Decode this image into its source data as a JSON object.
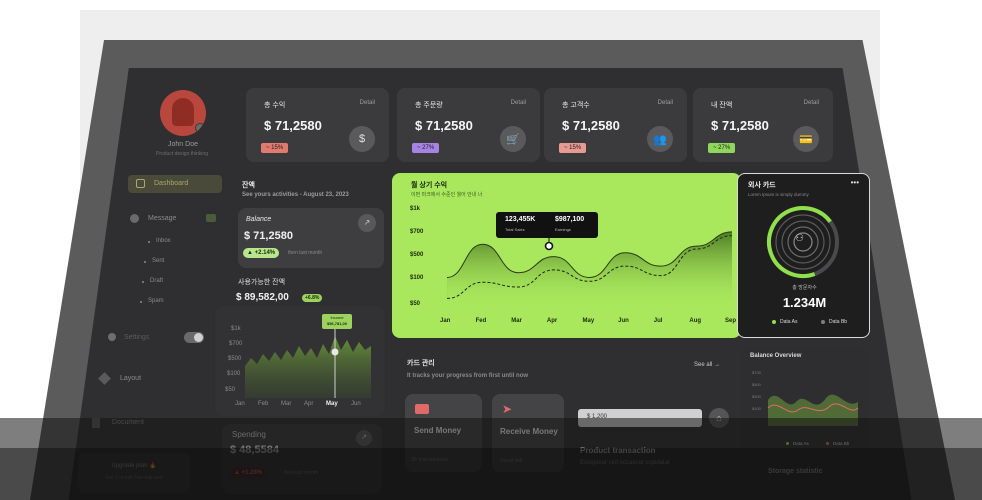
{
  "profile": {
    "name": "John Doe",
    "subtitle": "Product design thinking"
  },
  "sidebar": {
    "dashboard": "Dashboard",
    "message": "Message",
    "sub_items": [
      "Inbox",
      "Sent",
      "Draft",
      "Spam"
    ],
    "settings": "Settings",
    "layout": "Layout",
    "document": "Document",
    "upgrade_title": "Upgrade plan 🔥",
    "upgrade_text": "Get 1 month free trial and"
  },
  "stats": [
    {
      "title": "총 수익",
      "detail": "Detail",
      "value": "$ 71,2580",
      "badge": "~ 15%",
      "badge_color": "#e07a6e",
      "icon": "dollar-icon",
      "glyph": "$"
    },
    {
      "title": "총 주문량",
      "detail": "Detail",
      "value": "$ 71,2580",
      "badge": "~ 27%",
      "badge_color": "#a584e6",
      "icon": "cart-icon",
      "glyph": "🛒"
    },
    {
      "title": "총 고객수",
      "detail": "Detail",
      "value": "$ 71,2580",
      "badge": "~ 15%",
      "badge_color": "#e79a92",
      "icon": "users-icon",
      "glyph": "👥"
    },
    {
      "title": "내 잔액",
      "detail": "Detail",
      "value": "$ 71,2580",
      "badge": "~ 27%",
      "badge_color": "#8fd65a",
      "icon": "wallet-icon",
      "glyph": "💳"
    }
  ],
  "activity": {
    "title": "잔액",
    "subtitle": "See yours activities - August 23, 2023",
    "balance_label": "Balance",
    "balance_value": "$ 71,2580",
    "balance_change": "▲ +2.14%",
    "balance_change_note": "then last month",
    "available_label": "사용가능한 잔액",
    "available_value": "$ 89,582,00",
    "available_badge": "+6.8%",
    "tooltip_label": "Income",
    "tooltip_value": "$56,781,00",
    "y_ticks": [
      "$1k",
      "$700",
      "$500",
      "$100",
      "$50"
    ],
    "months": [
      "Jan",
      "Feb",
      "Mar",
      "Apr",
      "May",
      "Jun"
    ],
    "spending_label": "Spending",
    "spending_value": "$ 48,5584",
    "spending_change": "▲ +1.28%",
    "spending_note": "then last month"
  },
  "sales": {
    "title": "월 상기 수익",
    "subtitle": "이번 마크에서 수준인 월어 안내 너",
    "tooltip_left_value": "123,455K",
    "tooltip_left_label": "Total Sales",
    "tooltip_right_value": "$987,100",
    "tooltip_right_label": "Earnings",
    "chart_data": {
      "type": "area",
      "x": [
        "Jan",
        "Fed",
        "Mar",
        "Apr",
        "May",
        "Jun",
        "Jul",
        "Aug",
        "Sep"
      ],
      "y_ticks": [
        "$1k",
        "$700",
        "$500",
        "$100",
        "$50"
      ],
      "series": [
        {
          "values": [
            300,
            650,
            350,
            520,
            300,
            560,
            420,
            630,
            780
          ]
        },
        {
          "values": [
            80,
            250,
            200,
            380,
            260,
            420,
            320,
            600,
            740
          ]
        }
      ]
    }
  },
  "wallet": {
    "title": "외사 카드",
    "menu": "•••",
    "subtitle": "Lorem Ipsum is simply dummy",
    "total_label": "총 방문자수",
    "total_value": "1.234M",
    "legend_a": "Data As",
    "legend_b": "Data Bb",
    "color_a": "#8fe04a",
    "color_b": "#7f7f82"
  },
  "cards_section": {
    "title": "카드 관리",
    "subtitle": "It tracks your progress from first until now",
    "see_all": "See all →",
    "send_title": "Send Money",
    "send_sub": "36 transactions",
    "receive_title": "Receive Money",
    "receive_sub": "Send link",
    "amount_value": "$ 1,200",
    "product_title": "Product transaction",
    "product_sub": "Excepteur sint occaecat cupidatat"
  },
  "balance_overview": {
    "title": "Balance Overview",
    "y_ticks": [
      "$700",
      "$500",
      "$300",
      "$100"
    ],
    "legend_a": "Data As",
    "legend_b": "Data Bb"
  },
  "storage": {
    "title": "Storage statistic"
  }
}
